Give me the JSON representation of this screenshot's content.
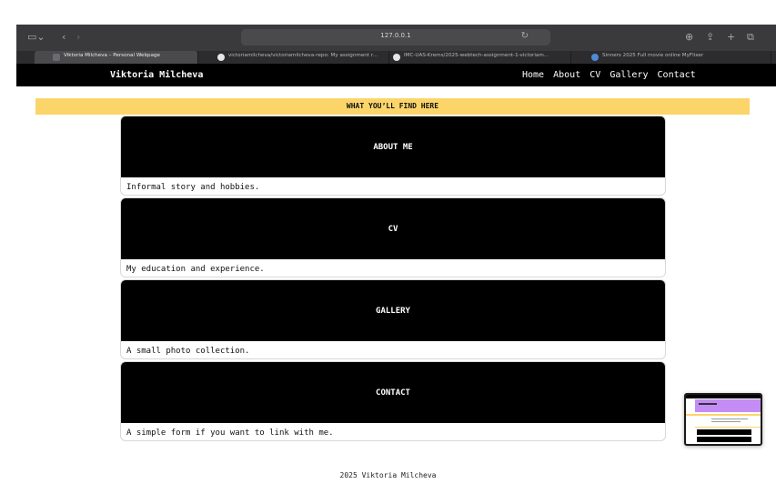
{
  "browser": {
    "url": "127.0.0.1",
    "tabs": [
      {
        "label": "Viktoria Milcheva – Personal Webpage",
        "active": true
      },
      {
        "label": "victoriamilcheva/victoriamilcheva-repo: My assignment r...",
        "active": false
      },
      {
        "label": "IMC-UAS-Krems/2025-webtech-assignment-1-victoriam...",
        "active": false
      },
      {
        "label": "Sinners 2025 Full movie online MyFlixer",
        "active": false
      }
    ]
  },
  "header": {
    "brand": "Viktoria Milcheva",
    "nav": [
      "Home",
      "About",
      "CV",
      "Gallery",
      "Contact"
    ]
  },
  "banner": {
    "text": "WHAT YOU’LL FIND HERE"
  },
  "cards": [
    {
      "title": "ABOUT ME",
      "description": "Informal story and hobbies."
    },
    {
      "title": "CV",
      "description": "My education and experience."
    },
    {
      "title": "GALLERY",
      "description": "A small photo collection."
    },
    {
      "title": "CONTACT",
      "description": "A simple form if you want to link with me."
    }
  ],
  "footer": {
    "text": "2025 Viktoria Milcheva"
  },
  "colors": {
    "banner": "#fcd56a",
    "header": "#000000",
    "thumbnail_accent": "#c48cf5"
  }
}
